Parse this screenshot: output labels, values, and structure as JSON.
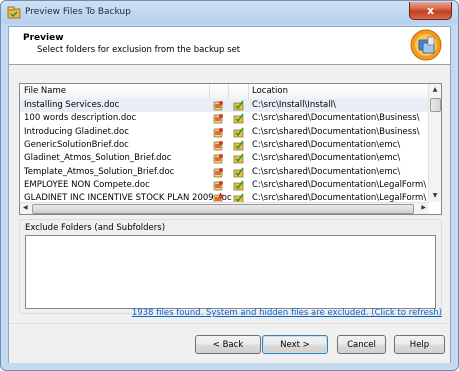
{
  "window": {
    "title": "Preview Files To Backup",
    "close_glyph": "x"
  },
  "header": {
    "title": "Preview",
    "subtitle": "Select folders for exclusion from the backup set",
    "icon": "backup-app-icon"
  },
  "file_list": {
    "columns": [
      "File Name",
      "Location"
    ],
    "rows": [
      {
        "name": "Installing Services.doc",
        "location": "C:\\src\\Install\\Install\\"
      },
      {
        "name": "100 words description.doc",
        "location": "C:\\src\\shared\\Documentation\\Business\\"
      },
      {
        "name": "Introducing Gladinet.doc",
        "location": "C:\\src\\shared\\Documentation\\Business\\"
      },
      {
        "name": "GenericSolutionBrief.doc",
        "location": "C:\\src\\shared\\Documentation\\emc\\"
      },
      {
        "name": "Gladinet_Atmos_Solution_Brief.doc",
        "location": "C:\\src\\shared\\Documentation\\emc\\"
      },
      {
        "name": "Template_Atmos_Solution_Brief.doc",
        "location": "C:\\src\\shared\\Documentation\\emc\\"
      },
      {
        "name": "EMPLOYEE NON Compete.doc",
        "location": "C:\\src\\shared\\Documentation\\LegalForm\\"
      },
      {
        "name": "GLADINET INC INCENTIVE STOCK PLAN 2009.doc",
        "location": "C:\\src\\shared\\Documentation\\LegalForm\\"
      }
    ],
    "row_icons": [
      "document-icon",
      "folder-check-icon"
    ]
  },
  "exclude_group": {
    "label": "Exclude Folders (and Subfolders)"
  },
  "status": {
    "text": "1938 files found. System and hidden files are excluded. (Click to refresh)"
  },
  "buttons": {
    "back": "< Back",
    "next": "Next >",
    "cancel": "Cancel",
    "help": "Help"
  },
  "scroll_glyphs": {
    "up": "▲",
    "down": "▼",
    "left": "◀",
    "right": "▶"
  }
}
